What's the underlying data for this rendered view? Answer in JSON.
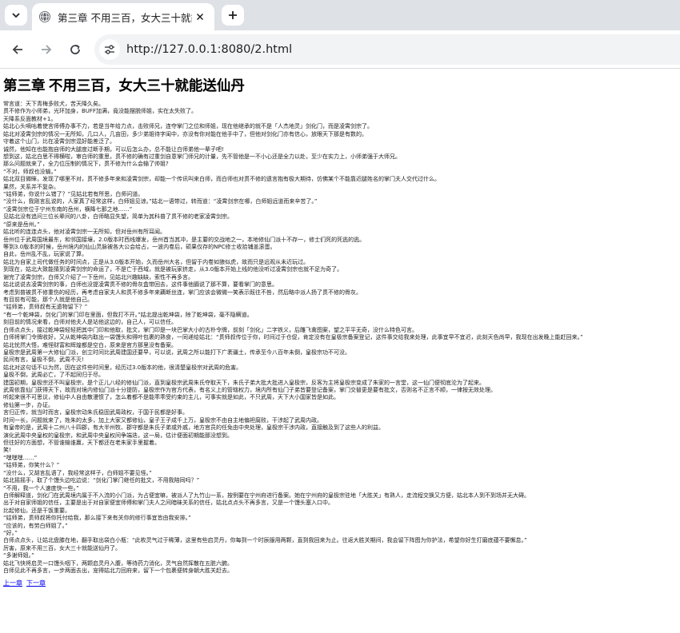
{
  "tab": {
    "title": "第三章 不用三百，女大三十就能送仙丹"
  },
  "address_bar": {
    "url": "http://127.0.0.1:8080/2.html"
  },
  "icons": {
    "tab_menu": "chevron-down-icon",
    "favicon": "globe-icon",
    "close": "close-icon",
    "new_tab": "plus-icon",
    "back": "arrow-left-icon",
    "forward": "arrow-right-icon",
    "reload": "reload-icon",
    "site_info": "tune-icon"
  },
  "page": {
    "title": "第三章 不用三百，女大三十就能送仙丹",
    "lines": [
      "常言道：天下青梅多败犬，苦天降久矣。",
      "贯不修作为小师弟，光环加身，BUFF加满，竟没能摆脱师姐，实在太失败了。",
      "天降系反面教材+1。",
      "姑北心头嘀咕着使言师傅办事不力，若是当年给力点，击败师兄，连夺掌门之位和师姐，现在他继承的就不是「人杰地灵」剑化门，而是凌霄剑宗了。",
      "姑北对凌霄剑宗的情况一无所知，几口人，几亩田，多少弟姐待字闺中，亦没有你对能在他手中了，但他对剑化门亦有信心，放眼天下那是有数的。",
      "守着这个山门，比在凌霄剑宗混好能差泛了。",
      "诚然，他知在也能抱自师的大腿度过断手期，可以后怎么办，总不能让白师弟他一辈子吧!",
      "想到这，姑北白思不得横啦，审白师的重思，贯不修的确有过重剑自意掌门师兄的计量，先不管他是一不小心还是全力以赴，至少在实力上，小师弟强于大师兄。",
      "那么问题就来了，全力位压制的情况下，贯不修为什么会输了帅姐?",
      "“不对，师叔也没输。”",
      "姑北双目微眯，发现了哪里不对，贯不修多年来和凌霄剑宗，却能一个传讯叫来白师，而白师也对贯不修的遗言抱有极大期待，仿佛某个不能靠近腿姓名的掌门夫人交代过什么。",
      "果然，关系并不复杂。",
      "“姑师弟，你说什么错了？”见姑北若有所思，白师问道。",
      "“没什么，我刚言乱说的，人家真了经常这样，白师姐见谅。”姑北一语带过，转而道：“凌霄剑宗在哪，白师姐远道而来辛苦了。”",
      "“凌霄剑宗位于宁州东南的岳州，横降七那之地……”",
      "见姑北没有追问三位长辈间的八卦，白师略显失望，简单为其科普了贯不修的老家凌霄剑宗。",
      "“原来是岳州。”",
      "姑北听的连连点头，他对凌霄剑宗一无所知，但对岳州有所耳闻。",
      "岳州位于武周国境最东，和邻国接壤，2.0版本时西线爆发，岳州首当其冲，是主要的交战地之一，本地修仙门派十不存一，修士们死的死逃的逃。",
      "等到3.0版本的时候，岳州境内的仙山灵脉被各大公会给占，一波内卷后，硕果仅存的NPC修士收拾铺盖滚蛋。",
      "自此，岳州乱不乱，玩家说了算。",
      "姑北为自家上司代做任务的时间点，正是从3.0版本开始，久而岳州大名，但留于内卷如狼似虎，故而只是远观从未近玩过。",
      "到现在，姑北大致能猜到凌霄剑宗的命运了，不是亡于西域，就是被玩家挤走，从3.0版本开始上线的他没听过凌霄剑宗也就不足为奇了。",
      "谢完了凌霄剑宗，白师又介绍了一下岳州，见姑北兴趣缺缺，索性不再多言。",
      "姑北说说去凌霄剑宗的事，白师也没提凌霄贯不修的骨灰盒带回去，这件事他膈说了那不算，要看掌门的意思。",
      "考虑到普被贯不修重伤的经历，再考虑自家夫人和贯不修多年来藕断丝连，掌门应该会微微一笑表示既往不咎，然后略中派人扬了贯不修的骨灰。",
      "有目前有可能，那个人就是他自己。",
      "“姑师弟，贯师叔有无遗物留下？”",
      "“有一个乾坤袋，剑化门的掌门印在里面，但我打不开。”姑北提出乾坤袋，除了乾坤袋，毫不隐瞒道。",
      "刻目前的情况来看，白师对他夫人是站他这边的，自己人，可以信任。",
      "白师点点头，接过乾坤袋轻轻把其中门印和他取，批文，掌门印是一块巴掌大小的古朴令牌，前刻「剑化」二字铁义，后雕飞禽图案，望之平平无奇，没什么特色可言。",
      "白师将掌门令牌收好，又从乾坤袋内取出一袋馒头和得叶包裹的熟食，一同递给姑北：“贯师叔传位于你，时间过于仓促，肯定没有在皇极宗备案登记，这件事交给我来处理，此事宜早不宜迟，此刻天色尚早，我现在出发晚上能赶回来。”",
      "姑北忧然大悟，难怪财富和辉煌都是空白，原来是官方那里没有备案。",
      "皇极宗是武周第一大修仙门派，创立时间比武周建国还要早，可以说，武周之所以能打下广袤疆土，传承至今八百年未倒，皇极宗功不可没。",
      "民间有言，皇极不倒，武周不灭!",
      "姑北对这句话不以为然，因在这件些时间里，经历过3.0版本的他，很清楚皇极宗对武周的危害。",
      "皇极不倒，武周必亡，了不起同归于尽。",
      "建国初期，皇极宗还不叫皇极宗，是个正儿八经的修仙门派，直到皇极宗武周朱氏夺取天下，朱氏子弟大批大批进入皇极宗，反客为主将皇极宗变成了朱家的一言堂，这一仙门便彻底沦为了起来。",
      "武周依靠仙门获得天下，故而对境内修仙门派十分提防，皇极宗作为官方代表，有名义上的管辖权力，境内所有仙门子弟皆要登记备案，掌门交替更是要有批文，否则名不正言不顺，一律按无效处理。",
      "听起来很不可思议，修仙中人自由散漫惯了，怎么着都不是能乖乖受约束的主儿，可事实就是如此，不只武周，天下大小国家皆是如此。",
      "修仙第一步，办证。",
      "言归正传，就当时而言，皇极宗动朱氏稳固武周政权，于国于民都是好事。",
      "时间一长，问题就来了，姓朱的太多，加上大家又都修仙，皇子王子成千上万，皇极宗不由自主地偏袒腐败，干涉起了武周内政。",
      "有皇帝的是，武周十二州八十四郡，有大半州牧、郡守都是朱氏子弟或外戚，地方官员的任免由中央处理，皇极宗干涉内政，直接触及到了这些人的利益。",
      "演化武周中央皇权的皇极宗，和武周中央皇权间争端迭，这一局，估计便面初期能那没想到。",
      "但往好的方面想，不管谁输谁赢，天下都还在老朱家手里握着。",
      "笑!",
      "“嘿嘿嘿……”",
      "“姑师弟，你笑什么？”",
      "“没什么，又胡言乱语了，我经常这样子，白师姐不要见怪。”",
      "姑北摇摇手，取了个馒头边吃边说：“剑化门掌门继任的批文，不用我陪同吗？”",
      "“不用，我一个人速度快一些。”",
      "白师解释道，剑化门在武周境内属于不入流的小门派，为占便宜嘛，被派人了九竹山一系，按例要在宁州府进行备案。她在宁州府的皇极宗驻地「大胜关」有熟人，走流程交换又方便，姑北本人到不到场并无大碍。",
      "出于对自家师姐的信任，主要是出于对自家便宜师傅和掌门夫人之间暗昧关系的信任，姑北点点头不再多言，又是一个馒头塞入口中。",
      "比起修仙，还是干饭重要。",
      "“姑师弟，贯师叔将你托付给我，那么接下来有关你的修行事宜皆由我安排。”",
      "“应该的，有劳白师姐了。”",
      "“好。”",
      "白师点点头，让姑北盘膝在地，翻手取出袋白小瓶：“此枚灵气过于稀薄，这里有些启灵丹，你每到一个时辰服用两颗，直到我回来为止。往返大胜关期间，我会留下阵图为你护法，希望你好生打磨底蕴不要懈怠。”",
      "厉害，原来不用三百，女大三十就能送仙丹了。",
      "“多谢师姐。”",
      "姑北飞快将启灵一口馒头咽下，两颗启灵丹入腹，等待药力消化，灵气自然挥散在五脏六腑。",
      "白师见此不再多言，一步两面去出，宠得姑北力回府来，留下一个包裹便转身朝大胜关赶去。"
    ]
  },
  "nav": {
    "prev": "上一章",
    "next": "下一章"
  }
}
